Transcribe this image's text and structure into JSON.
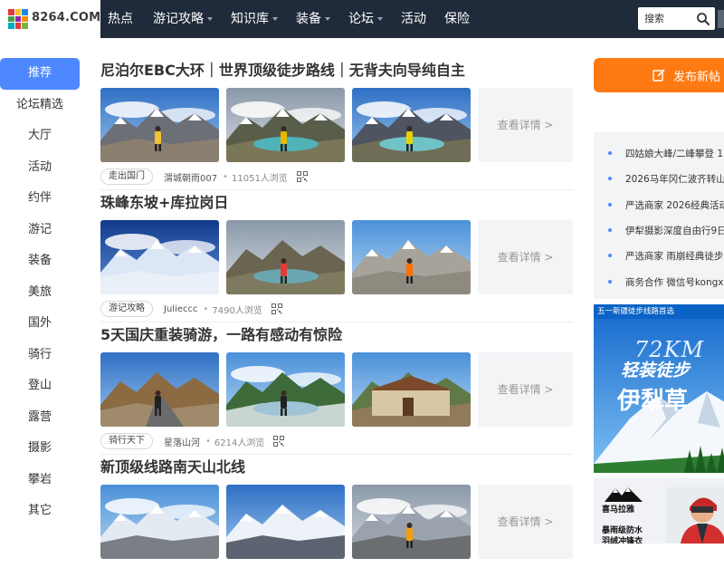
{
  "header": {
    "logo_text": "8264.COM",
    "nav": [
      {
        "label": "热点",
        "dropdown": false
      },
      {
        "label": "游记攻略",
        "dropdown": true
      },
      {
        "label": "知识库",
        "dropdown": true
      },
      {
        "label": "装备",
        "dropdown": true
      },
      {
        "label": "论坛",
        "dropdown": true
      },
      {
        "label": "活动",
        "dropdown": false
      },
      {
        "label": "保险",
        "dropdown": false
      }
    ],
    "search": {
      "placeholder": "搜索",
      "icon": "search-icon"
    }
  },
  "sidebar": {
    "items": [
      "推荐",
      "论坛精选",
      "大厅",
      "活动",
      "约伴",
      "游记",
      "装备",
      "美旅",
      "国外",
      "骑行",
      "登山",
      "露营",
      "摄影",
      "攀岩",
      "其它"
    ],
    "active_index": 0
  },
  "feed": {
    "more_label": "查看详情 >",
    "posts": [
      {
        "title": "尼泊尔EBC大环｜世界顶级徒步路线｜无背夫向导纯自主",
        "tag": "走出国门",
        "author": "渭城朝雨007",
        "views": "11051人浏览"
      },
      {
        "title": "珠峰东坡+库拉岗日",
        "tag": "游记攻略",
        "author": "Julieccc",
        "views": "7490人浏览"
      },
      {
        "title": "5天国庆重装骑游，一路有感动有惊险",
        "tag": "骑行天下",
        "author": "星落山河",
        "views": "6214人浏览"
      },
      {
        "title": "新顶级线路南天山北线",
        "tag": "",
        "author": "",
        "views": ""
      }
    ]
  },
  "right": {
    "post_button": "发布新帖",
    "notices": [
      "四姑娘大峰/二峰攀登 1",
      "2026马年冈仁波齐转山",
      "严选商家 2026经典活动",
      "伊犁摄影深度自由行9日",
      "严选商家 雨崩经典徒步",
      "商务合作 微信号kongxi"
    ],
    "ad1": {
      "strip": "五一新疆徒步线路首选",
      "big": "72KM",
      "sub": "轻装徒步",
      "main": "伊犁草"
    },
    "ad2": {
      "brand": "喜马拉雅",
      "line1": "暴雨级防水",
      "line2": "羽绒冲锋衣"
    }
  },
  "colors": {
    "header_bg": "#1f2a3a",
    "accent_blue": "#4d88ff",
    "accent_orange": "#ff7a12"
  }
}
